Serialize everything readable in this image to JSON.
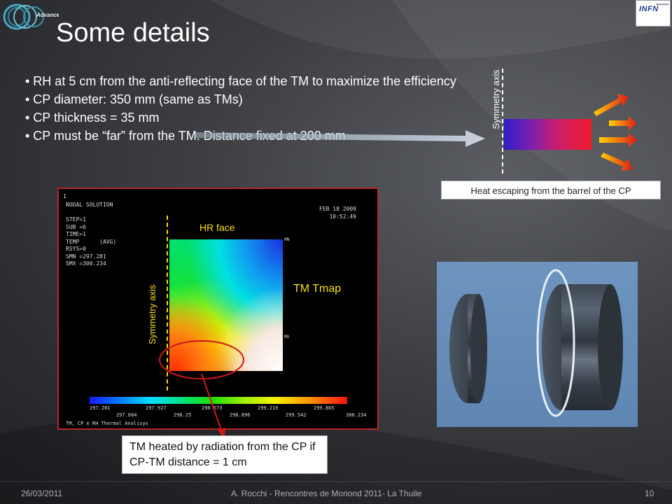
{
  "slide": {
    "title": "Some details",
    "bullets": [
      "• RH at 5 cm from the anti-reflecting face of the TM to maximize the efficiency",
      "• CP diameter: 350 mm (same as TMs)",
      "• CP thickness = 35 mm",
      "• CP must be “far” from the TM. Distance fixed at 200 mm"
    ]
  },
  "logos": {
    "left_text": "Advanced Virgo",
    "right_text": "INFN"
  },
  "barrel_figure": {
    "symmetry_label": "Symmetry axis",
    "caption": "Heat escaping from the barrel of the CP"
  },
  "ansys_plot": {
    "index": "1",
    "header_lines": "NODAL SOLUTION\n\nSTEP=1\nSUB =6\nTIME=1\nTEMP      (AVG)\nRSYS=0\nSMN =297.281\nSMX =300.234",
    "date_lines": "FEB 18 2009\n10:52:49",
    "mn_label": "MN",
    "mx_label": "MX",
    "hr_face": "HR face",
    "tm_tmap": "TM Tmap",
    "symmetry_axis": "Symmetry axis",
    "colorbar_ticks_top": [
      "297.281",
      "297.927",
      "298.573",
      "299.219",
      "299.865"
    ],
    "colorbar_ticks_bottom": [
      "297.604",
      "298.25",
      "298.896",
      "299.542",
      "300.234"
    ],
    "footer": "TM, CP e RH Thermal Analisys",
    "callout": "TM heated by radiation from the CP if CP-TM distance = 1 cm"
  },
  "footer": {
    "date": "26/03/2011",
    "center": "A. Rocchi - Rencontres de Moriond 2011- La Thuile",
    "page": "10"
  }
}
